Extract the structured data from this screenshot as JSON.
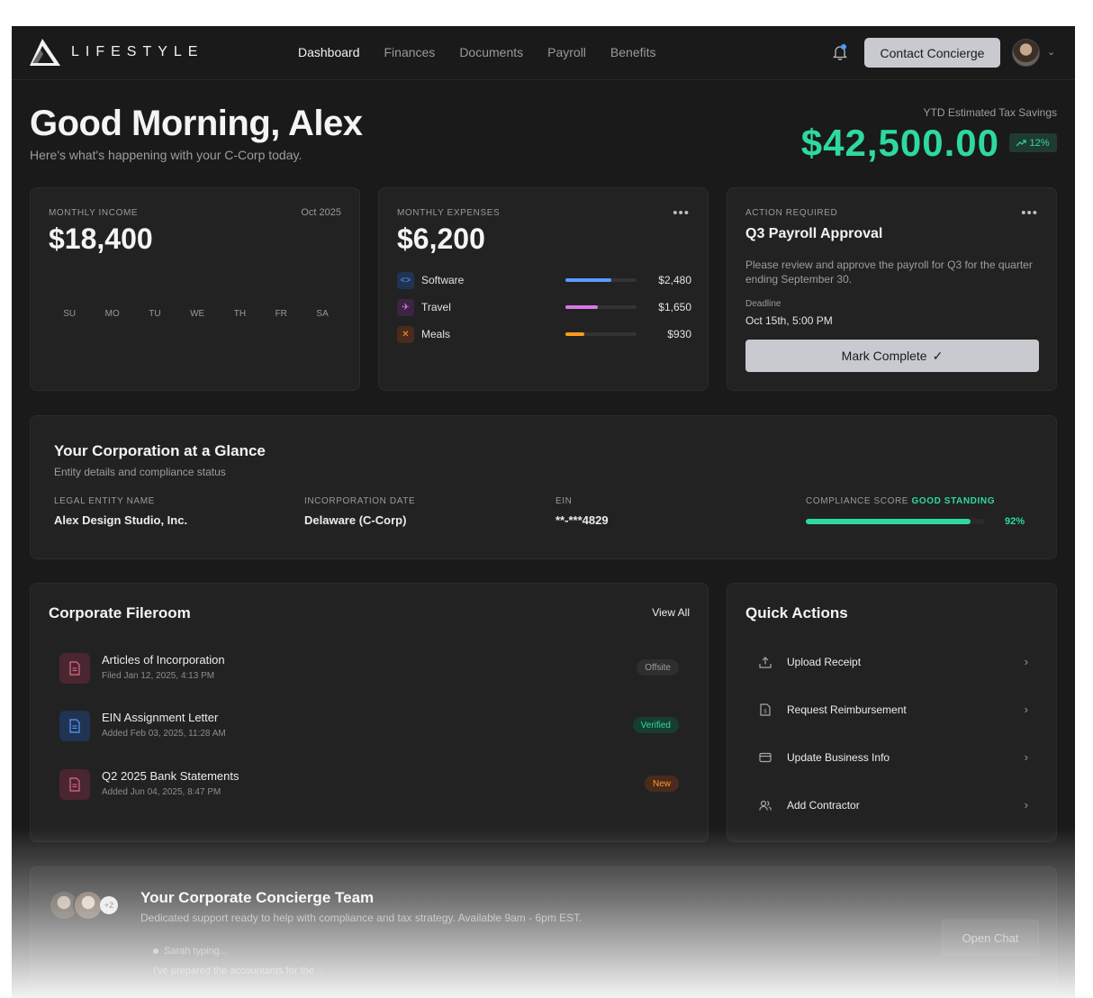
{
  "brand": {
    "name": "LIFESTYLE"
  },
  "nav": {
    "items": [
      {
        "label": "Dashboard",
        "active": true
      },
      {
        "label": "Finances"
      },
      {
        "label": "Documents"
      },
      {
        "label": "Payroll"
      },
      {
        "label": "Benefits"
      }
    ],
    "concierge_button": "Contact Concierge",
    "icons": {
      "notifications": "bell-icon",
      "profile_menu": "chevron-down-icon"
    }
  },
  "greeting": {
    "title": "Good Morning, Alex",
    "subtitle": "Here's what's happening with your C-Corp today."
  },
  "ytd": {
    "label": "YTD Estimated Tax Savings",
    "value": "$42,500.00",
    "change": "12%"
  },
  "income": {
    "label": "MONTHLY INCOME",
    "date": "Oct 2025",
    "amount": "$18,400",
    "days": [
      "SU",
      "MO",
      "TU",
      "WE",
      "TH",
      "FR",
      "SA"
    ]
  },
  "expenses": {
    "label": "MONTHLY EXPENSES",
    "amount": "$6,200",
    "items": [
      {
        "name": "Software",
        "value": "$2,480",
        "fraction": 0.65,
        "color": "#5b9bff",
        "icon": "code-icon"
      },
      {
        "name": "Travel",
        "value": "$1,650",
        "fraction": 0.46,
        "color": "#d977e6",
        "icon": "plane-icon"
      },
      {
        "name": "Meals",
        "value": "$930",
        "fraction": 0.26,
        "color": "#ff9a1f",
        "icon": "utensils-icon"
      }
    ]
  },
  "action": {
    "label": "ACTION REQUIRED",
    "title": "Q3 Payroll Approval",
    "description": "Please review and approve the payroll for Q3 for the quarter ending September 30.",
    "deadline_label": "Deadline",
    "deadline": "Oct 15th, 5:00 PM",
    "button": "Mark Complete"
  },
  "glance": {
    "title": "Your Corporation at a Glance",
    "subtitle": "Entity details and compliance status",
    "entity_label": "LEGAL ENTITY NAME",
    "entity": "Alex Design Studio, Inc.",
    "incorporation_label": "INCORPORATION DATE",
    "incorporation": "Delaware (C-Corp)",
    "ein_label": "EIN",
    "ein": "**-***4829",
    "score_label": "COMPLIANCE SCORE",
    "score_status": "GOOD STANDING",
    "score": "92%",
    "score_fraction": 0.92
  },
  "fileroom": {
    "title": "Corporate Fileroom",
    "view_all": "View All",
    "files": [
      {
        "name": "Articles of Incorporation",
        "meta": "Filed Jan 12, 2025, 4:13 PM",
        "badge": "Offsite",
        "badge_bg": "#2e2e2e",
        "badge_fg": "#9d9d9d",
        "icon_bg": "#4a2630",
        "icon_fg": "#e46b86"
      },
      {
        "name": "EIN Assignment Letter",
        "meta": "Added Feb 03, 2025, 11:28 AM",
        "badge": "Verified",
        "badge_bg": "#173d31",
        "badge_fg": "#2ed9a0",
        "icon_bg": "#1f3352",
        "icon_fg": "#5b9bff"
      },
      {
        "name": "Q2 2025 Bank Statements",
        "meta": "Added Jun 04, 2025, 8:47 PM",
        "badge": "New",
        "badge_bg": "#4a2a1c",
        "badge_fg": "#ff9a1f",
        "icon_bg": "#4a2630",
        "icon_fg": "#e46b86"
      }
    ]
  },
  "quick": {
    "title": "Quick Actions",
    "items": [
      {
        "label": "Upload Receipt",
        "icon": "upload-icon"
      },
      {
        "label": "Request Reimbursement",
        "icon": "document-icon"
      },
      {
        "label": "Update Business Info",
        "icon": "card-icon"
      },
      {
        "label": "Add Contractor",
        "icon": "users-icon"
      }
    ]
  },
  "team": {
    "title": "Your Corporate Concierge Team",
    "subtitle": "Dedicated support ready to help with compliance and tax strategy. Available 9am - 6pm EST.",
    "more": "+2",
    "typing": "Sarah typing...",
    "message": "I've prepared the accountants for the ...",
    "button": "Open Chat"
  }
}
